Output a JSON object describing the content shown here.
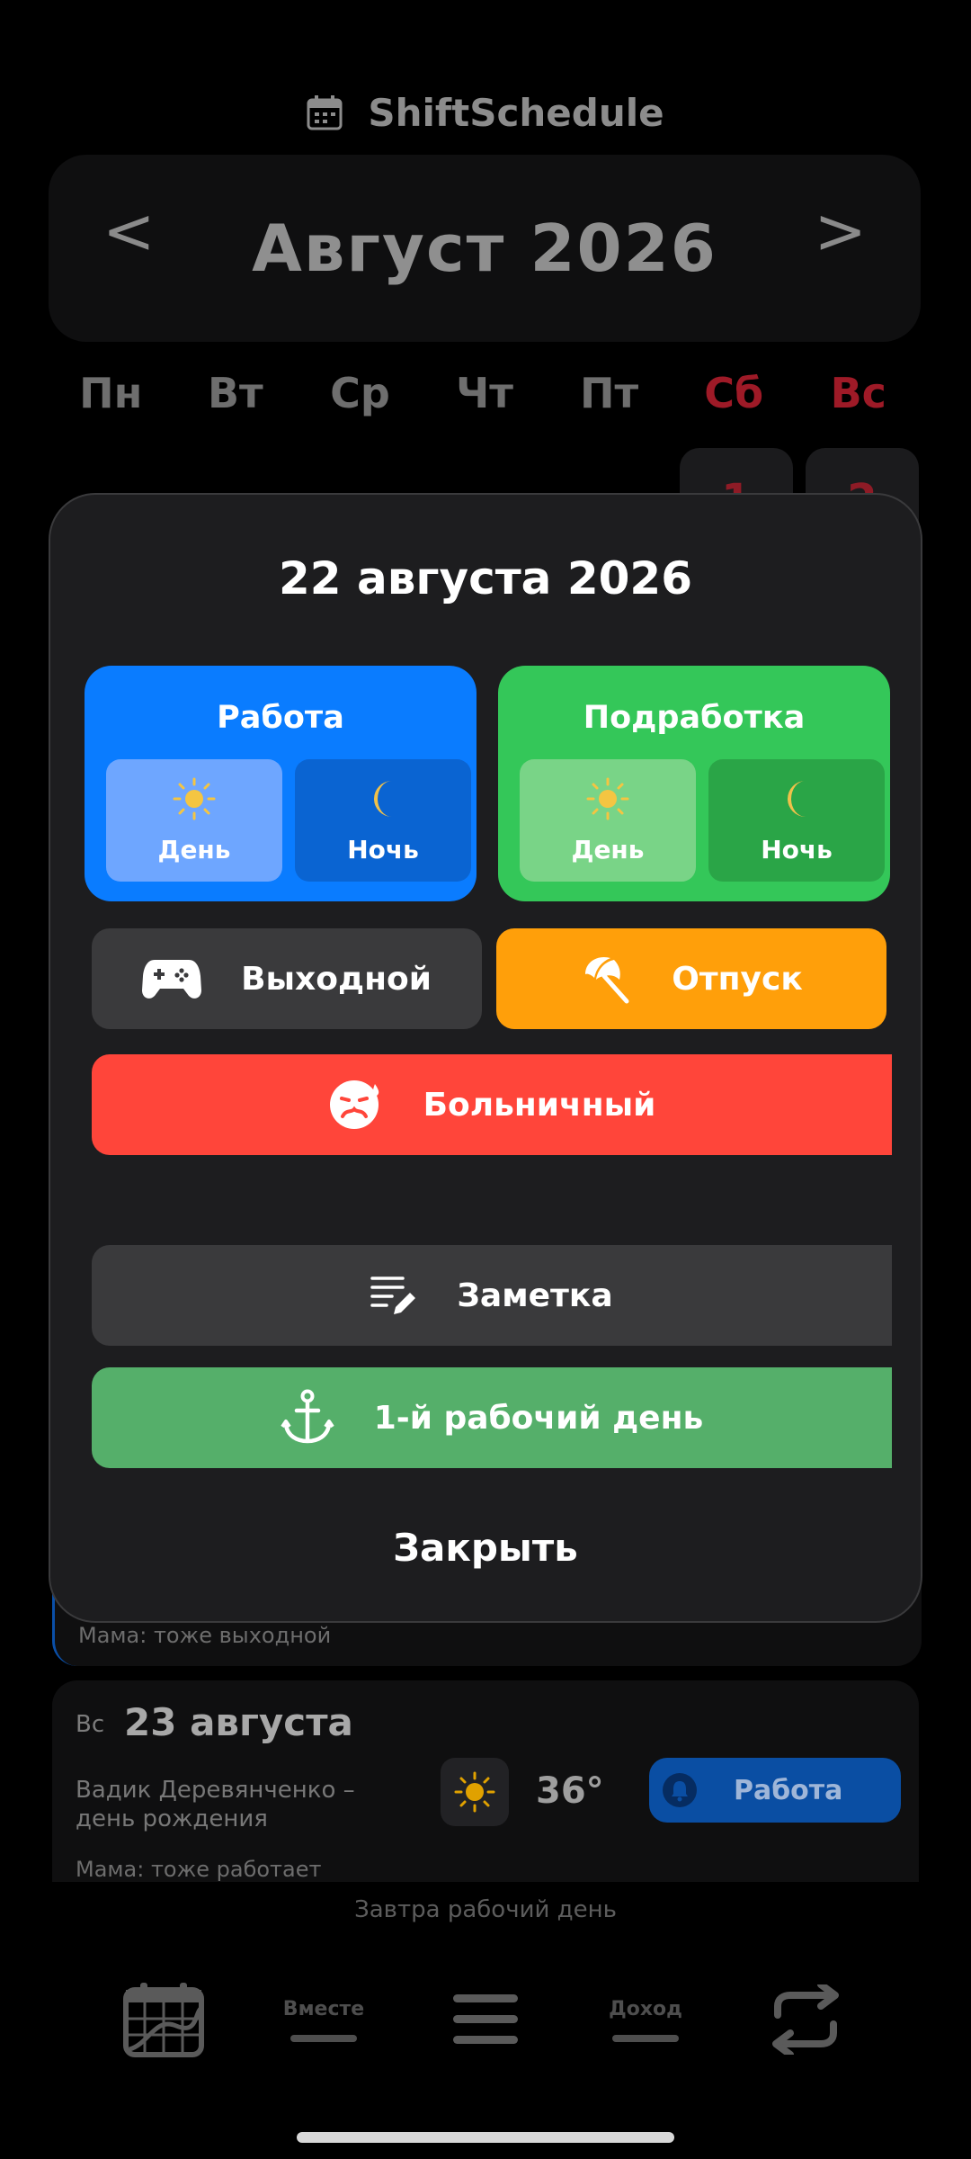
{
  "app": {
    "title": "ShiftSchedule"
  },
  "calendar": {
    "prev": "<",
    "next": ">",
    "month_label": "Август 2026",
    "weekdays": [
      "Пн",
      "Вт",
      "Ср",
      "Чт",
      "Пт",
      "Сб",
      "Вс"
    ],
    "days_visible": [
      "1",
      "2"
    ]
  },
  "modal": {
    "title": "22 августа 2026",
    "work": {
      "label": "Работа",
      "day": "День",
      "night": "Ночь",
      "color": "#0a7cff"
    },
    "side_job": {
      "label": "Подработка",
      "day": "День",
      "night": "Ночь",
      "color": "#34c759"
    },
    "day_off": "Выходной",
    "vacation": "Отпуск",
    "sick": "Больничный",
    "note": "Заметка",
    "first_workday": "1-й рабочий день",
    "close": "Закрыть"
  },
  "list": {
    "card1_note": "Мама: тоже выходной",
    "card2": {
      "dow": "Вс",
      "date": "23 августа",
      "event": "Вадик Деревянченко – день рождения",
      "temperature": "36°",
      "status": "Работа",
      "note": "Мама: тоже работает"
    }
  },
  "footer": {
    "tomorrow": "Завтра рабочий день",
    "nav_together": "Вместе",
    "nav_income": "Доход"
  },
  "colors": {
    "vacation": "#ff9f0a",
    "sick": "#ff453a",
    "first_workday": "#55af6a",
    "neutral_button": "#3a3a3c"
  }
}
